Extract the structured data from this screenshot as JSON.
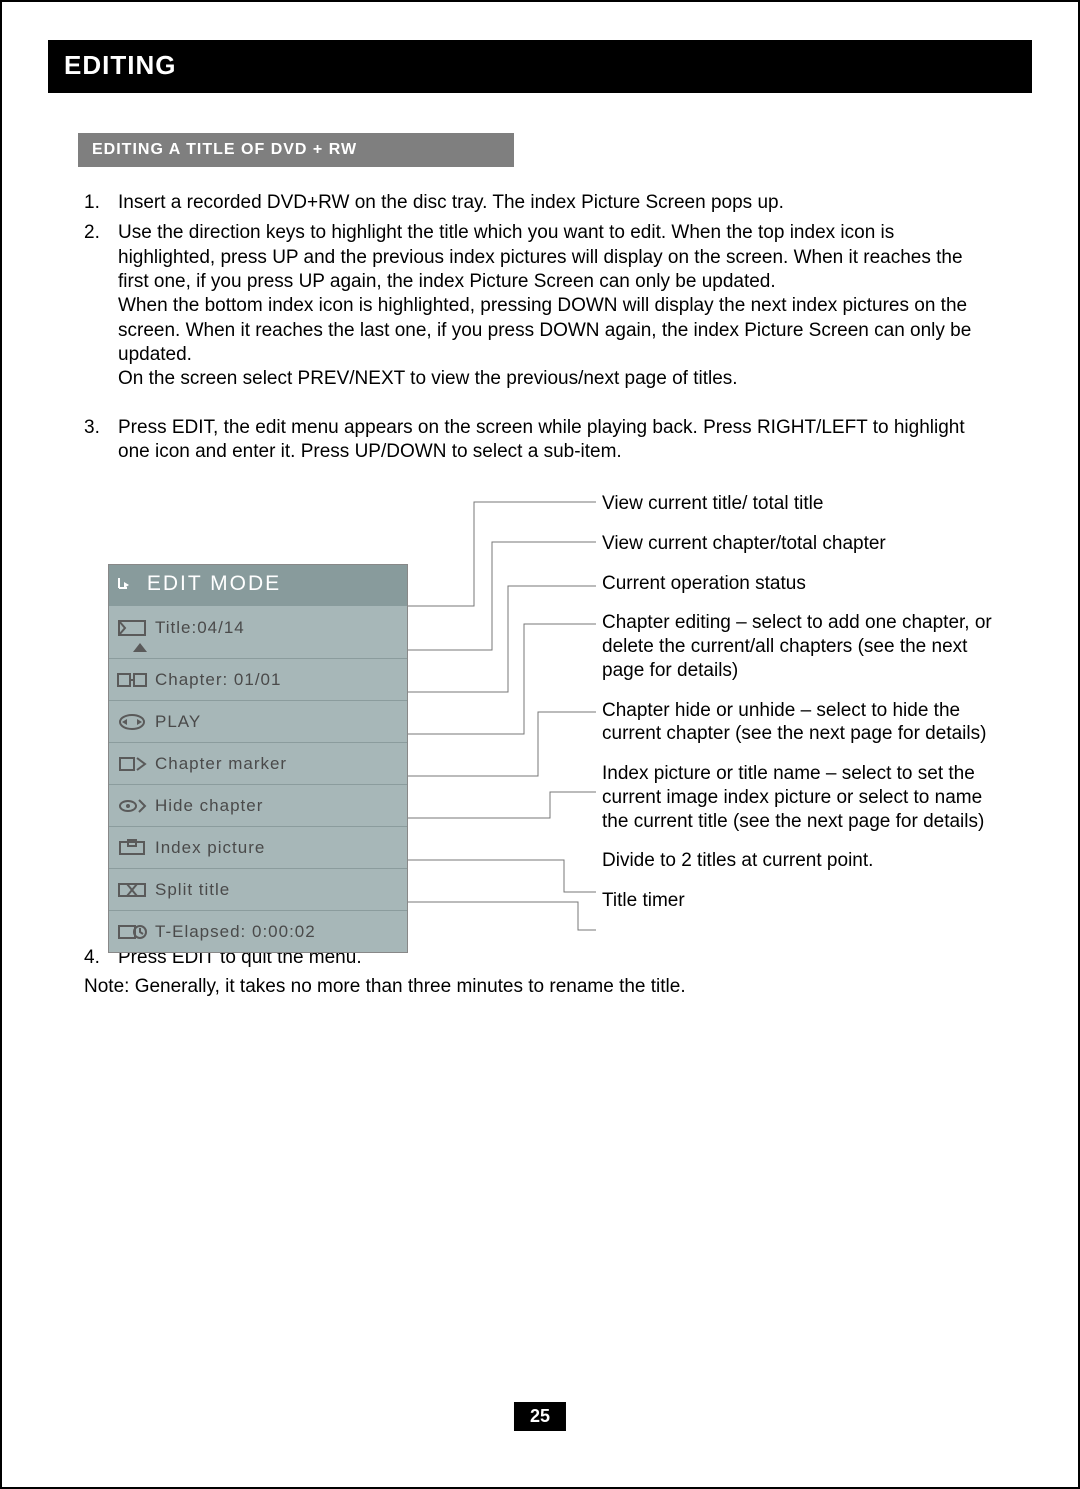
{
  "header": {
    "title": "EDITING"
  },
  "section": {
    "subtitle": "EDITING A TITLE OF DVD + RW"
  },
  "steps": {
    "items": [
      {
        "num": "1.",
        "text": "Insert a recorded DVD+RW on the disc tray. The index Picture Screen pops up."
      },
      {
        "num": "2.",
        "text": "Use the direction keys to highlight the title which you want to edit. When the top index icon is highlighted, press UP and the previous index pictures will display on the screen. When it reaches the first one, if you press UP again, the index Picture Screen can only be updated.\nWhen the bottom index icon is highlighted, pressing DOWN will display the next index pictures on the screen. When it reaches the last one, if you press DOWN again, the index Picture Screen can only be updated.\nOn the screen select PREV/NEXT to view the previous/next page of titles."
      },
      {
        "num": "3.",
        "text": "Press EDIT, the edit menu appears on the screen while playing back. Press RIGHT/LEFT to highlight one icon and enter it. Press UP/DOWN to select a sub-item."
      }
    ]
  },
  "panel": {
    "title": "EDIT MODE",
    "rows": [
      {
        "icon": "title-icon",
        "label": "Title:04/14"
      },
      {
        "icon": "chapter-icon",
        "label": "Chapter: 01/01"
      },
      {
        "icon": "play-icon",
        "label": "PLAY"
      },
      {
        "icon": "marker-icon",
        "label": "Chapter marker"
      },
      {
        "icon": "hide-icon",
        "label": "Hide chapter"
      },
      {
        "icon": "index-icon",
        "label": "Index picture"
      },
      {
        "icon": "split-icon",
        "label": "Split title"
      },
      {
        "icon": "elapsed-icon",
        "label": "T-Elapsed: 0:00:02"
      }
    ]
  },
  "callouts": {
    "items": [
      "View current title/ total title",
      "View current chapter/total chapter",
      "Current operation status",
      "Chapter editing – select to add one chapter, or delete the current/all chapters (see the next page for details)",
      "Chapter hide or unhide – select to hide the current chapter (see the next page for details)",
      "Index picture or title name – select to set the current image index picture or select to name the current title (see the next page for details)",
      "Divide to 2 titles at current point.",
      "Title timer"
    ]
  },
  "after": {
    "step4_num": "4.",
    "step4": "Press EDIT to quit the menu.",
    "note": "Note: Generally, it takes no more than three minutes to rename the title."
  },
  "page_number": "25"
}
